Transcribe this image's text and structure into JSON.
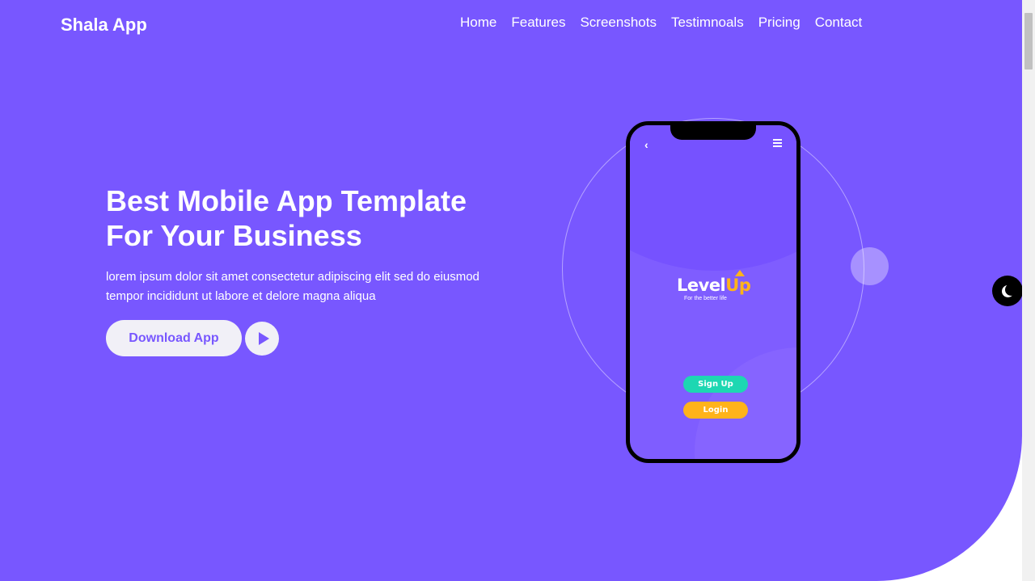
{
  "brand": "Shala App",
  "nav": {
    "home": "Home",
    "features": "Features",
    "screenshots": "Screenshots",
    "testimonials": "Testimnoals",
    "pricing": "Pricing",
    "contact": "Contact"
  },
  "hero": {
    "title_line1": "Best Mobile App Template",
    "title_line2": "For Your Business",
    "description_line1": "lorem ipsum dolor sit amet consectetur adipiscing elit sed do eiusmod",
    "description_line2": "tempor incididunt ut labore et delore magna aliqua",
    "download_label": "Download App"
  },
  "phone": {
    "back_icon": "‹",
    "logo_main": "Level",
    "logo_accent": "Up",
    "logo_tagline": "For the better life",
    "signup_label": "Sign Up",
    "login_label": "Login"
  },
  "colors": {
    "primary": "#7857ff",
    "signup": "#1dd7b2",
    "login": "#ffb31a"
  },
  "icons": {
    "play": "play-icon",
    "theme": "moon-icon",
    "menu": "hamburger-icon",
    "back": "back-chevron-icon"
  }
}
